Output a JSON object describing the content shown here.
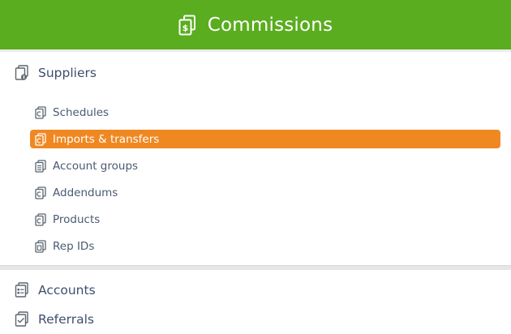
{
  "header": {
    "title": "Commissions",
    "icon": "dollar-documents-icon",
    "background": "#5aad1e"
  },
  "menu": {
    "suppliers": {
      "label": "Suppliers",
      "icon": "supplier-documents-icon",
      "items": [
        {
          "label": "Schedules",
          "icon": "documents-icon",
          "active": false
        },
        {
          "label": "Imports & transfers",
          "icon": "documents-icon",
          "active": true
        },
        {
          "label": "Account groups",
          "icon": "documents-list-icon",
          "active": false
        },
        {
          "label": "Addendums",
          "icon": "documents-icon",
          "active": false
        },
        {
          "label": "Products",
          "icon": "documents-icon",
          "active": false
        },
        {
          "label": "Rep IDs",
          "icon": "documents-id-icon",
          "active": false
        }
      ]
    },
    "accounts": {
      "label": "Accounts",
      "icon": "documents-list-icon"
    },
    "referrals": {
      "label": "Referrals",
      "icon": "documents-check-icon"
    }
  },
  "colors": {
    "active_item": "#f08822",
    "text": "#4a5a72"
  }
}
